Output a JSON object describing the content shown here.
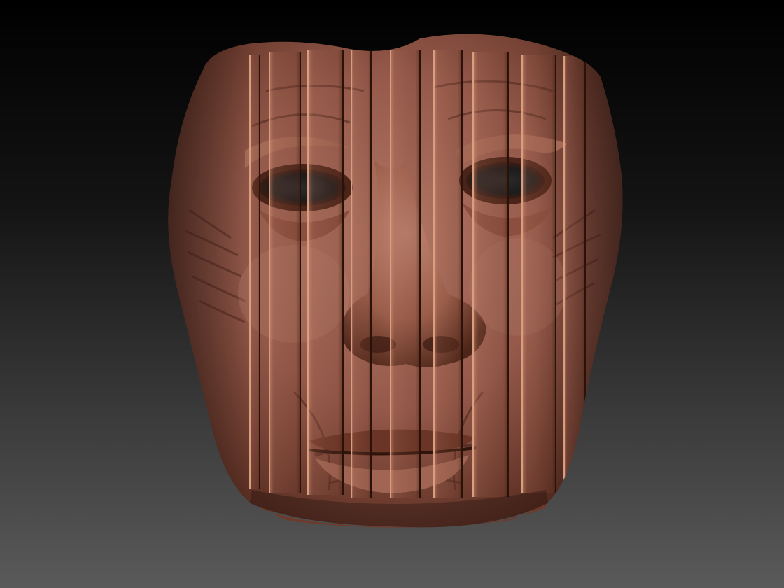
{
  "scene": {
    "subject": "sculpted-face-mask",
    "colors": {
      "background_top": "#000000",
      "background_bottom": "#5a5a5a",
      "skin_light": "#b87a64",
      "skin_mid": "#8e5442",
      "skin_dark": "#4a2418",
      "strip_edge": "#c98a6e"
    },
    "strip_count": 8
  }
}
